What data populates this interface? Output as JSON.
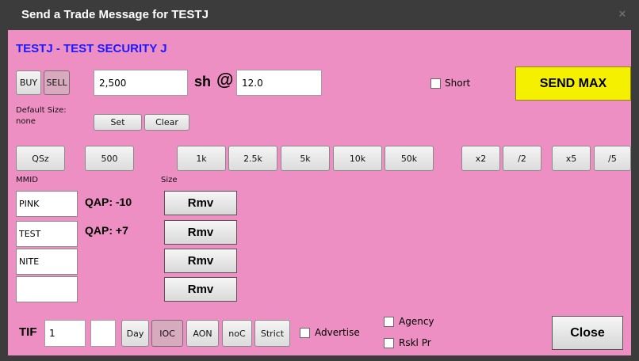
{
  "window": {
    "title": "Send a Trade Message for TESTJ",
    "close_glyph": "✕"
  },
  "security": {
    "heading": "TESTJ - TEST SECURITY J"
  },
  "order": {
    "buy_label": "BUY",
    "sell_label": "SELL",
    "size_value": "2,500",
    "sh_at_label": "sh",
    "at_symbol": "@",
    "price_value": "12.0",
    "short_label": "Short",
    "short_checked": false,
    "send_max_label": "SEND MAX"
  },
  "default_size": {
    "label": "Default Size:",
    "value": "none",
    "set_label": "Set",
    "clear_label": "Clear"
  },
  "size_buttons": {
    "qsz": "QSz",
    "s500": "500",
    "s1k": "1k",
    "s2_5k": "2.5k",
    "s5k": "5k",
    "s10k": "10k",
    "s50k": "50k",
    "x2": "x2",
    "div2": "/2",
    "x5": "x5",
    "div5": "/5"
  },
  "mm_section": {
    "mmid_header": "MMID",
    "size_header": "Size",
    "rows": [
      {
        "mmid": "PINK",
        "qap": "QAP: -10",
        "rmv": "Rmv"
      },
      {
        "mmid": "TEST",
        "qap": "QAP: +7",
        "rmv": "Rmv"
      },
      {
        "mmid": "NITE",
        "qap": "",
        "rmv": "Rmv"
      },
      {
        "mmid": "",
        "qap": "",
        "rmv": "Rmv"
      }
    ]
  },
  "tif": {
    "label": "TIF",
    "value": "1",
    "extra_value": "",
    "day": "Day",
    "ioc": "IOC",
    "aon": "AON",
    "noc": "noC",
    "strict": "Strict",
    "advertise": "Advertise",
    "agency": "Agency",
    "rskl_pr": "Rskl Pr"
  },
  "close_label": "Close",
  "colors": {
    "panel_bg": "#ed8fc2",
    "title_bg": "#3c3c3c",
    "heading_blue": "#1a1aff",
    "send_max_yellow": "#f4f000",
    "pressed_pink": "#d8aabd"
  }
}
